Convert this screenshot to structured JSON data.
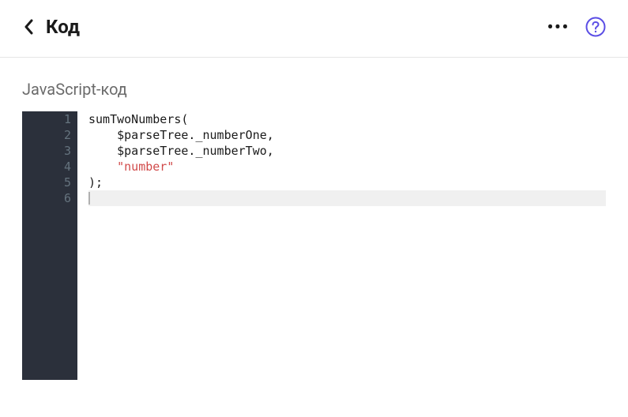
{
  "header": {
    "title": "Код"
  },
  "section": {
    "label": "JavaScript-код"
  },
  "editor": {
    "lines": [
      {
        "num": "1",
        "fold": true,
        "segments": [
          {
            "text": "sumTwoNumbers(",
            "cls": "token-plain"
          }
        ]
      },
      {
        "num": "2",
        "fold": false,
        "segments": [
          {
            "text": "    $parseTree._numberOne,",
            "cls": "token-plain"
          }
        ]
      },
      {
        "num": "3",
        "fold": false,
        "segments": [
          {
            "text": "    $parseTree._numberTwo,",
            "cls": "token-plain"
          }
        ]
      },
      {
        "num": "4",
        "fold": false,
        "segments": [
          {
            "text": "    ",
            "cls": "token-plain"
          },
          {
            "text": "\"number\"",
            "cls": "token-string"
          }
        ]
      },
      {
        "num": "5",
        "fold": false,
        "segments": [
          {
            "text": ");",
            "cls": "token-plain"
          }
        ]
      },
      {
        "num": "6",
        "fold": false,
        "active": true,
        "segments": []
      }
    ]
  }
}
